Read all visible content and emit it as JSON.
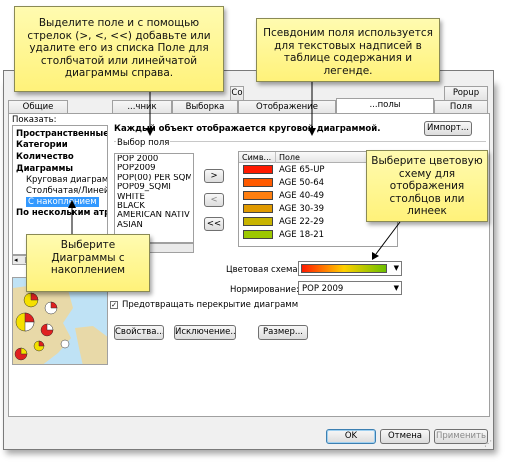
{
  "callouts": {
    "top_left": "Выделите поле и с помощью стрелок (>, <, <<) добавьте или удалите его из списка Поле для столбчатой или линейчатой диаграммы справа.",
    "top_mid": "Псевдоним поля используется для текстовых надписей в таблице содержания и легенде.",
    "right": "Выберите цветовую схему для отображения столбцов или линеек",
    "left": "Выберите Диаграммы с накоплением"
  },
  "tabs_back": [
    "Со",
    "Popup"
  ],
  "tabs_front": [
    "Общие",
    "...чник",
    "Выборка",
    "Отображение",
    "...полы",
    "Поля"
  ],
  "show_label": "Показать:",
  "tree": {
    "items": [
      "Пространственные о",
      "Категории",
      "Количество",
      "Диаграммы",
      "Круговая диаграмм",
      "Столбчатая/Линейч",
      "С накоплением",
      "По нескольким атр"
    ]
  },
  "description": "Каждый объект отображается круговой диаграммой.",
  "import_button": "Импорт...",
  "field_selection_label": "Выбор поля",
  "fields": [
    "POP 2000",
    "POP2009",
    "POP(00) PER SQM",
    "POP09_SQMI",
    "WHITE",
    "BLACK",
    "AMERICAN NATIV",
    "ASIAN"
  ],
  "arrow_buttons": [
    ">",
    "<",
    "<<"
  ],
  "table": {
    "headers": [
      "Симв...",
      "Поле"
    ],
    "rows": [
      {
        "color": "#ff1a00",
        "field": "AGE 65-UP"
      },
      {
        "color": "#ff5a00",
        "field": "AGE 50-64"
      },
      {
        "color": "#ff7f10",
        "field": "AGE 40-49"
      },
      {
        "color": "#e09a00",
        "field": "AGE 30-39"
      },
      {
        "color": "#c8b400",
        "field": "AGE 22-29"
      },
      {
        "color": "#9cc800",
        "field": "AGE 18-21"
      }
    ]
  },
  "color_scheme_label": "Цветовая схема:",
  "normalization_label": "Нормирование:",
  "normalization_value": "POP 2009",
  "overlap_checkbox": "Предотвращать перекрытие диаграмм",
  "bottom_buttons": [
    "Свойства...",
    "Исключение...",
    "Размер..."
  ],
  "footer": {
    "ok": "OK",
    "cancel": "Отмена",
    "apply": "Применить"
  },
  "colors": {
    "ramp_start": "#ff1a00",
    "ramp_mid": "#ffd000",
    "ramp_end": "#6cc000",
    "selected": "#3399ff",
    "callout": "#fff27a"
  }
}
